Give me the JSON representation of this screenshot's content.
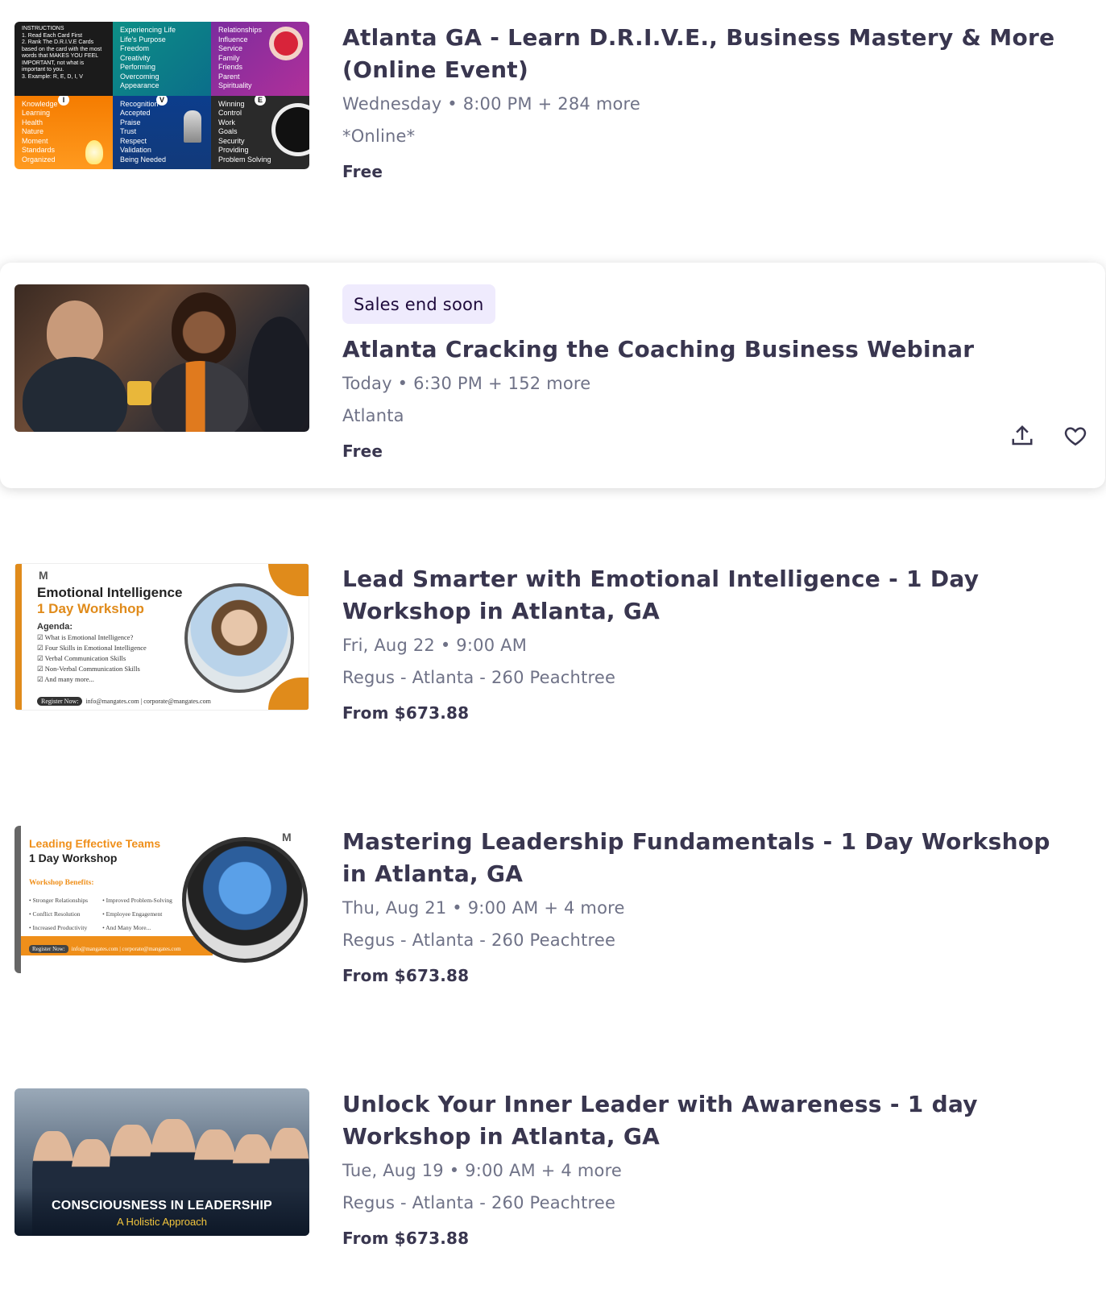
{
  "events": [
    {
      "title": "Atlanta GA - Learn D.R.I.V.E., Business Mastery & More (Online Event)",
      "date": "Wednesday • 8:00 PM + 284 more",
      "location": "*Online*",
      "price": "Free",
      "thumb": {
        "cells": [
          "INSTRUCTIONS\n1. Read Each Card First\n2. Rank The D.R.I.V.E Cards based on the card with the most words that MAKES YOU FEEL IMPORTANT, not what is important to you.\n3. Example: R, E, D, I, V",
          "Experiencing Life\nLife's Purpose\nFreedom\nCreativity\nPerforming\nOvercoming\nAppearance",
          "Relationships\nInfluence\nService\nFamily\nFriends\nParent\nSpirituality",
          "Knowledge\nLearning\nHealth\nNature\nMoment\nStandards\nOrganized",
          "Recognition\nAccepted\nPraise\nTrust\nRespect\nValidation\nBeing Needed",
          "Winning\nControl\nWork\nGoals\nSecurity\nProviding\nProblem Solving"
        ],
        "letters": [
          "I",
          "V",
          "E"
        ]
      }
    },
    {
      "badge": "Sales end soon",
      "title": "Atlanta Cracking the Coaching Business Webinar",
      "date": "Today • 6:30 PM + 152 more",
      "location": "Atlanta",
      "price": "Free",
      "actions": {
        "share_icon": "share-upload-icon",
        "like_icon": "heart-outline-icon"
      }
    },
    {
      "title": "Lead Smarter with Emotional Intelligence - 1 Day Workshop in Atlanta, GA",
      "date": "Fri, Aug 22 • 9:00 AM",
      "location": "Regus - Atlanta - 260 Peachtree",
      "price": "From $673.88",
      "thumb": {
        "logo": "M",
        "line1": "Emotional Intelligence",
        "line2": "1 Day Workshop",
        "agenda_label": "Agenda:",
        "agenda": [
          "What is Emotional Intelligence?",
          "Four Skills in Emotional Intelligence",
          "Verbal Communication Skills",
          "Non-Verbal Communication Skills",
          "And many more..."
        ],
        "register": "Register Now:",
        "contacts": "info@mangates.com  |  corporate@mangates.com"
      }
    },
    {
      "title": "Mastering Leadership Fundamentals - 1 Day Workshop in Atlanta, GA",
      "date": "Thu, Aug 21 • 9:00 AM + 4 more",
      "location": "Regus - Atlanta - 260 Peachtree",
      "price": "From $673.88",
      "thumb": {
        "logo": "M",
        "line1": "Leading Effective Teams",
        "line2": "1 Day Workshop",
        "benefits_label": "Workshop Benefits:",
        "col1": [
          "Stronger Relationships",
          "Conflict Resolution",
          "Increased Productivity"
        ],
        "col2": [
          "Improved Problem-Solving",
          "Employee Engagement",
          "And Many More..."
        ],
        "register": "Register Now:",
        "contacts": "info@mangates.com  |  corporate@mangates.com"
      }
    },
    {
      "title": "Unlock Your Inner Leader with Awareness - 1 day Workshop in Atlanta, GA",
      "date": "Tue, Aug 19 • 9:00 AM + 4 more",
      "location": "Regus - Atlanta - 260 Peachtree",
      "price": "From $673.88",
      "thumb": {
        "caption1": "CONSCIOUSNESS IN LEADERSHIP",
        "caption2": "A Holistic Approach"
      }
    }
  ]
}
